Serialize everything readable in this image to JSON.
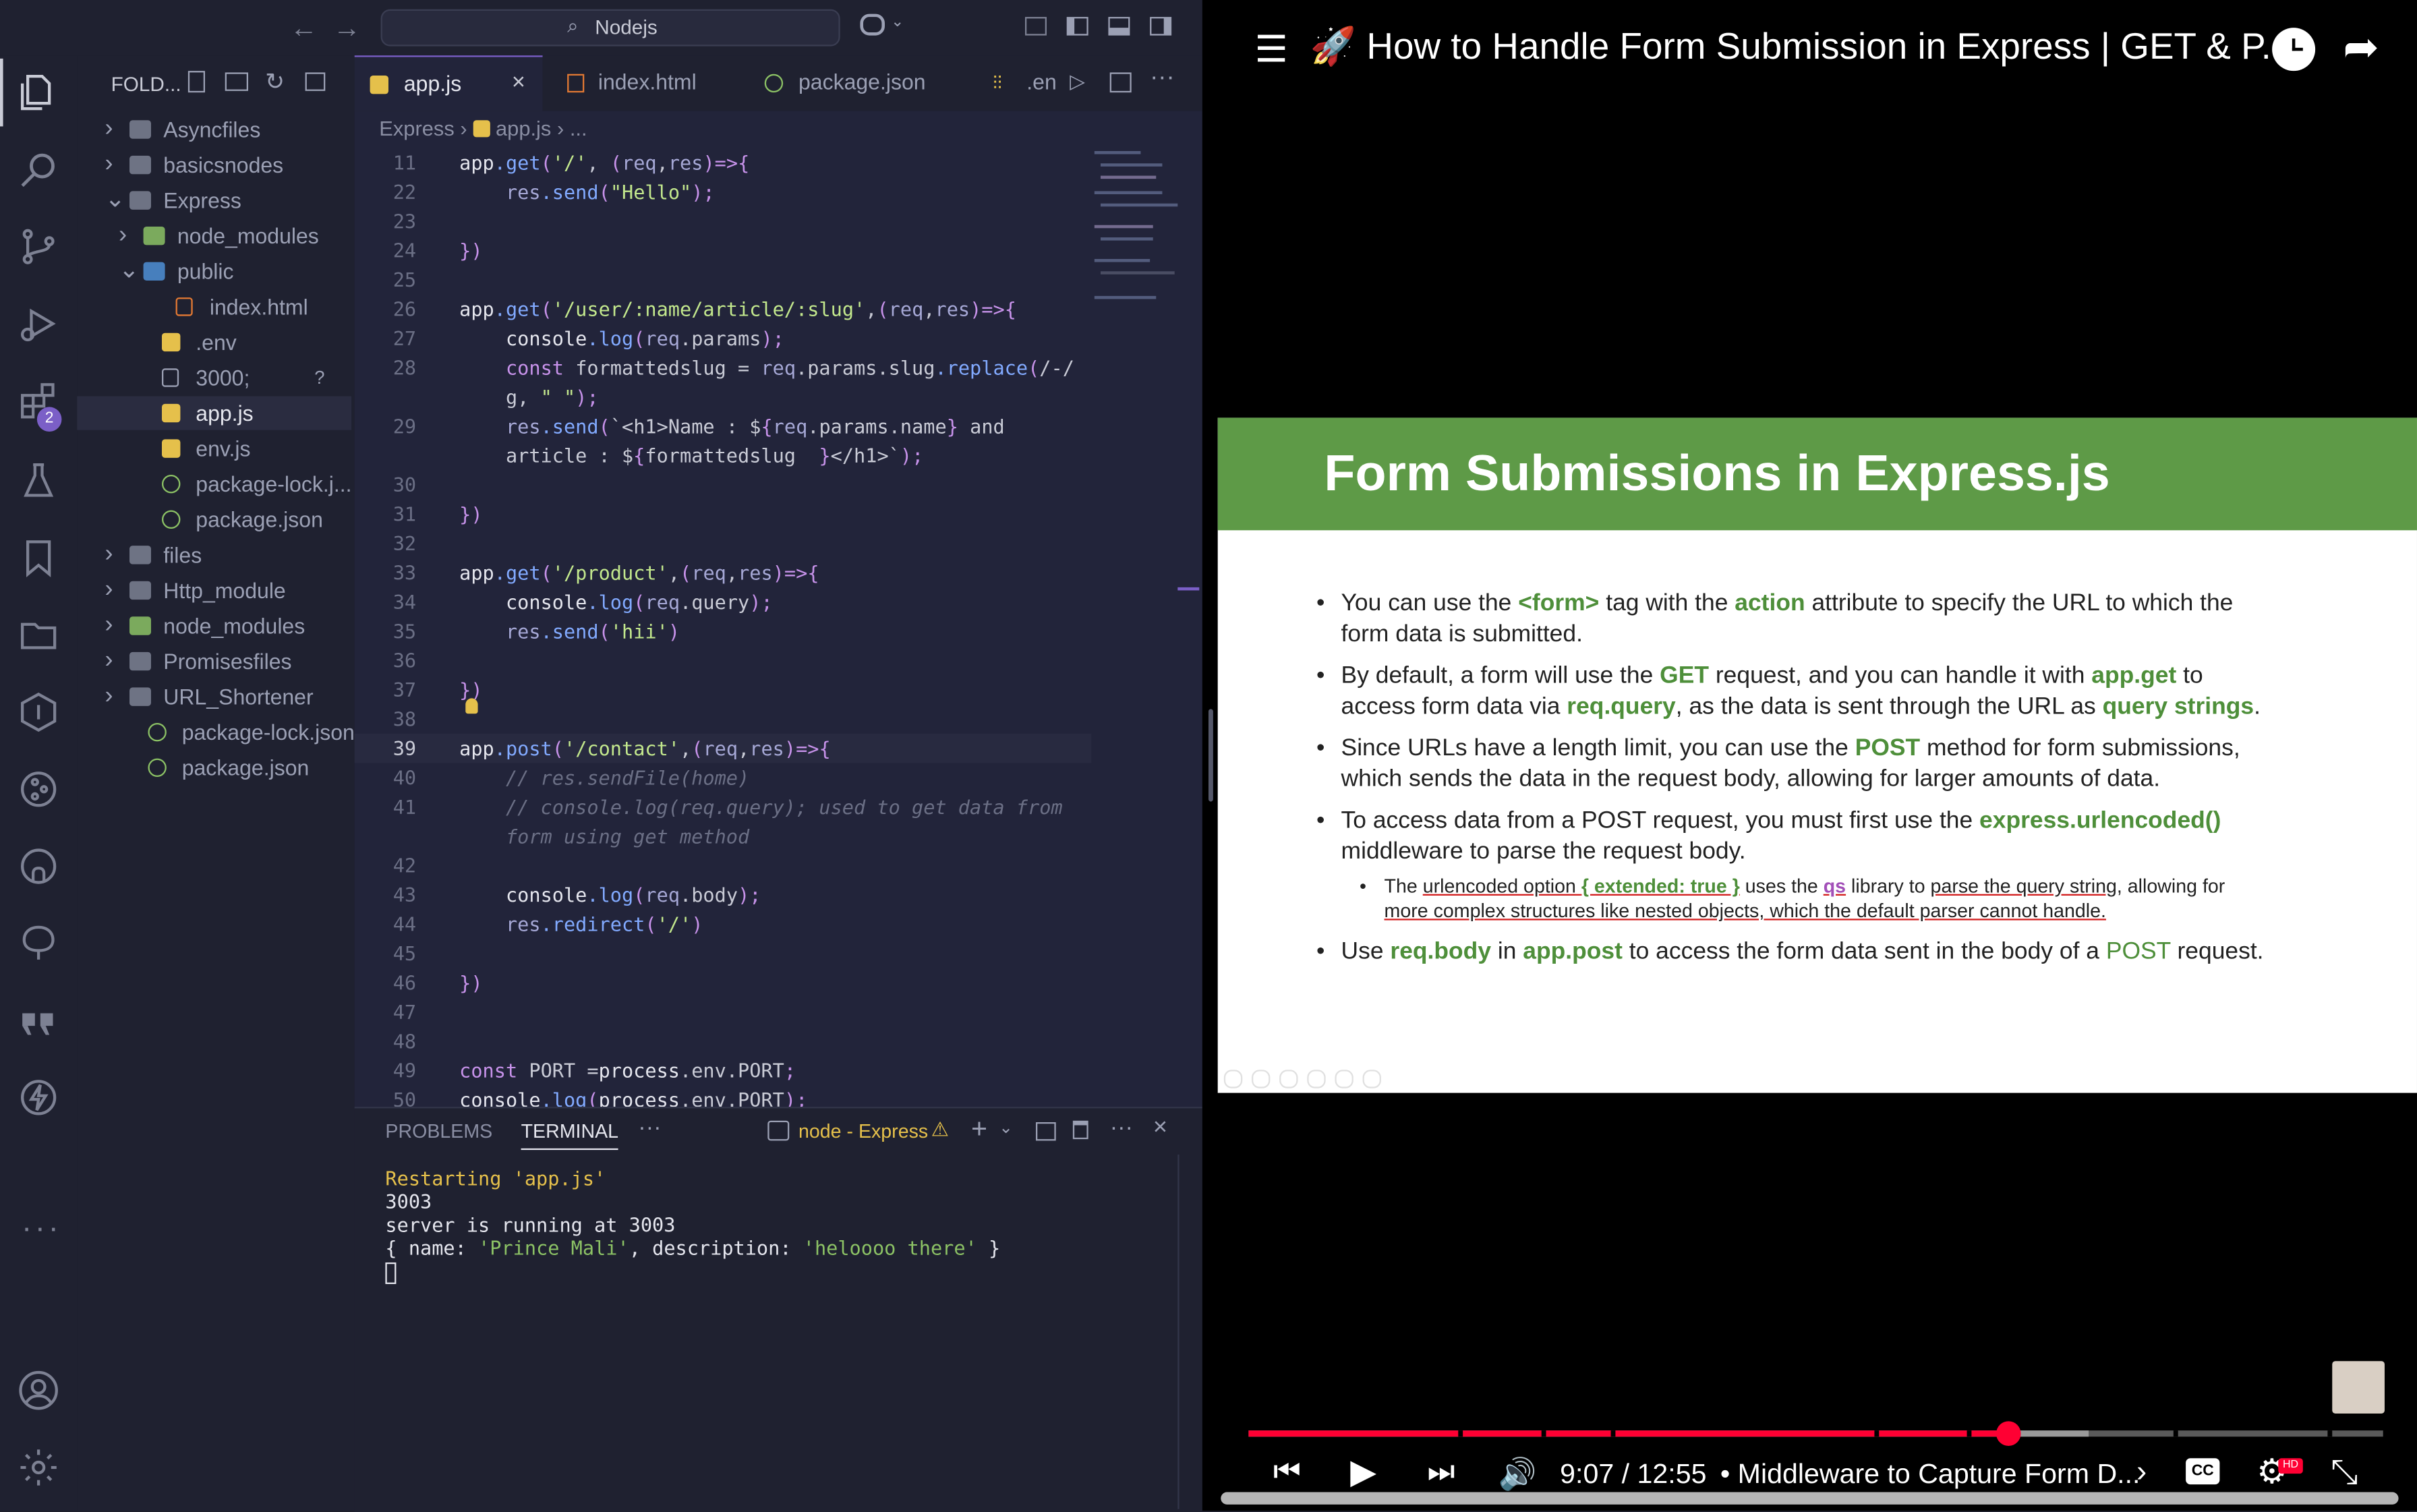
{
  "titlebar": {
    "search_text": "Nodejs"
  },
  "activity_badge": "2",
  "explorer": {
    "title": "FOLD...",
    "items": [
      {
        "label": "Asyncfiles",
        "kind": "folder",
        "depth": 0,
        "open": false
      },
      {
        "label": "basicsnodes",
        "kind": "folder",
        "depth": 0,
        "open": false
      },
      {
        "label": "Express",
        "kind": "folder",
        "depth": 0,
        "open": true
      },
      {
        "label": "node_modules",
        "kind": "folder-node",
        "depth": 1,
        "open": false
      },
      {
        "label": "public",
        "kind": "folder-public",
        "depth": 1,
        "open": true
      },
      {
        "label": "index.html",
        "kind": "html",
        "depth": 2
      },
      {
        "label": ".env",
        "kind": "env",
        "depth": 1
      },
      {
        "label": "3000;",
        "kind": "file",
        "depth": 1,
        "badge": "?"
      },
      {
        "label": "app.js",
        "kind": "js",
        "depth": 1,
        "selected": true
      },
      {
        "label": "env.js",
        "kind": "js",
        "depth": 1
      },
      {
        "label": "package-lock.j...",
        "kind": "json",
        "depth": 1
      },
      {
        "label": "package.json",
        "kind": "json",
        "depth": 1
      },
      {
        "label": "files",
        "kind": "folder",
        "depth": 0,
        "open": false
      },
      {
        "label": "Http_module",
        "kind": "folder",
        "depth": 0,
        "open": false
      },
      {
        "label": "node_modules",
        "kind": "folder-node",
        "depth": 0,
        "open": false
      },
      {
        "label": "Promisesfiles",
        "kind": "folder",
        "depth": 0,
        "open": false
      },
      {
        "label": "URL_Shortener",
        "kind": "folder",
        "depth": 0,
        "open": false
      },
      {
        "label": "package-lock.json",
        "kind": "json",
        "depth": 0
      },
      {
        "label": "package.json",
        "kind": "json",
        "depth": 0
      }
    ]
  },
  "tabs": [
    {
      "label": "app.js",
      "active": true
    },
    {
      "label": "index.html"
    },
    {
      "label": "package.json"
    },
    {
      "label": ".en"
    }
  ],
  "breadcrumb": {
    "folder": "Express",
    "file": "app.js",
    "rest": "..."
  },
  "code_lines": [
    {
      "n": "11",
      "t": "app.get('/', (req,res)=>{"
    },
    {
      "n": "22",
      "t": "    res.send(\"Hello\");"
    },
    {
      "n": "23",
      "t": ""
    },
    {
      "n": "24",
      "t": "})"
    },
    {
      "n": "25",
      "t": ""
    },
    {
      "n": "26",
      "t": "app.get('/user/:name/article/:slug',(req,res)=>{"
    },
    {
      "n": "27",
      "t": "    console.log(req.params);"
    },
    {
      "n": "28",
      "t": "    const formattedslug = req.params.slug.replace(/-/"
    },
    {
      "n": "",
      "t": "    g, \" \");"
    },
    {
      "n": "29",
      "t": "    res.send(`<h1>Name : ${req.params.name} and"
    },
    {
      "n": "",
      "t": "    article : ${formattedslug  }</h1>`);"
    },
    {
      "n": "30",
      "t": ""
    },
    {
      "n": "31",
      "t": "})"
    },
    {
      "n": "32",
      "t": ""
    },
    {
      "n": "33",
      "t": "app.get('/product',(req,res)=>{"
    },
    {
      "n": "34",
      "t": "    console.log(req.query);"
    },
    {
      "n": "35",
      "t": "    res.send('hii')"
    },
    {
      "n": "36",
      "t": ""
    },
    {
      "n": "37",
      "t": "})"
    },
    {
      "n": "38",
      "t": ""
    },
    {
      "n": "39",
      "t": "app.post('/contact',(req,res)=>{",
      "active": true
    },
    {
      "n": "40",
      "t": "    // res.sendFile(home)",
      "comment": true
    },
    {
      "n": "41",
      "t": "    // console.log(req.query); used to get data from",
      "comment": true
    },
    {
      "n": "",
      "t": "    form using get method",
      "comment": true
    },
    {
      "n": "42",
      "t": ""
    },
    {
      "n": "43",
      "t": "    console.log(req.body);"
    },
    {
      "n": "44",
      "t": "    res.redirect('/')"
    },
    {
      "n": "45",
      "t": ""
    },
    {
      "n": "46",
      "t": "})"
    },
    {
      "n": "47",
      "t": ""
    },
    {
      "n": "48",
      "t": ""
    },
    {
      "n": "49",
      "t": "const PORT =process.env.PORT;"
    },
    {
      "n": "50",
      "t": "console.log(process.env.PORT);"
    }
  ],
  "panel": {
    "tab_problems": "PROBLEMS",
    "tab_terminal": "TERMINAL",
    "terminal_name": "node - Express",
    "lines": [
      "Restarting 'app.js'",
      "3003",
      "server is running at 3003",
      "{ name: 'Prince Mali', description: 'heloooo there' }"
    ]
  },
  "video": {
    "title": "🚀 How to Handle Form Submission in Express | GET & P...",
    "time": "9:07 / 12:55",
    "chapter": "• Middleware to Capture Form D...",
    "progress": 0.67,
    "buffered": 0.74,
    "slide": {
      "heading": "Form Submissions in Express.js",
      "b1_a": "You can use the ",
      "b1_form": "<form>",
      "b1_b": " tag with the ",
      "b1_action": "action",
      "b1_c": " attribute to specify the URL to which the",
      "b1_line2": "form data is submitted.",
      "b2_a": "By default, a form will use the ",
      "b2_get": "GET",
      "b2_b": " request, and you can handle it with ",
      "b2_appget": "app.get",
      "b2_c": " to",
      "b2_d": "access form data via ",
      "b2_reqquery": "req.query",
      "b2_e": ", as the data is sent through the URL as ",
      "b2_qs": "query strings",
      "b2_f": ".",
      "b3_a": "Since URLs have a length limit, you can use the ",
      "b3_post": "POST",
      "b3_b": " method for form submissions,",
      "b3_line2": "which sends the data in the request body, allowing for larger amounts of data.",
      "b4_a": "To access data from a POST request, you must first use the ",
      "b4_ue": "express.urlencoded()",
      "b4_line2": "middleware to parse the request body.",
      "s1_a": "The ",
      "s1_b": "urlencoded option ",
      "s1_ext": "{ extended: true }",
      "s1_c": " uses the ",
      "s1_qs": "qs",
      "s1_d": " library to ",
      "s1_e": "parse the query string",
      "s1_f": ", allowing for",
      "s1_line2": "more complex structures like nested objects, which the default parser cannot handle.",
      "b5_a": "Use ",
      "b5_rb": "req.body",
      "b5_b": " in ",
      "b5_ap": "app.post",
      "b5_c": " to access the form data sent in the body of a ",
      "b5_post": "POST",
      "b5_d": " request."
    }
  },
  "colors": {
    "accent": "#5e9a47",
    "youtube_red": "#f03",
    "vscode_bg": "#22243a"
  }
}
